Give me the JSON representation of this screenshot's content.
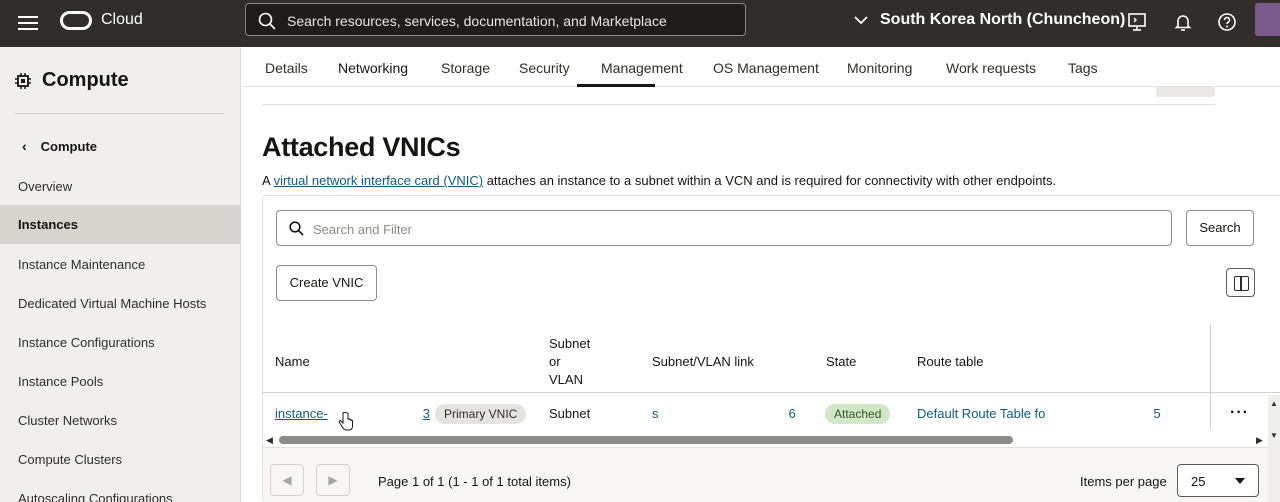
{
  "topbar": {
    "brand": "Cloud",
    "search_placeholder": "Search resources, services, documentation, and Marketplace",
    "region": "South Korea North (Chuncheon)"
  },
  "sidebar": {
    "title": "Compute",
    "back_label": "Compute",
    "items": [
      {
        "label": "Overview",
        "active": false
      },
      {
        "label": "Instances",
        "active": true
      },
      {
        "label": "Instance Maintenance",
        "active": false
      },
      {
        "label": "Dedicated Virtual Machine Hosts",
        "active": false
      },
      {
        "label": "Instance Configurations",
        "active": false
      },
      {
        "label": "Instance Pools",
        "active": false
      },
      {
        "label": "Cluster Networks",
        "active": false
      },
      {
        "label": "Compute Clusters",
        "active": false
      },
      {
        "label": "Autoscaling Configurations",
        "active": false
      }
    ]
  },
  "tabs": [
    {
      "label": "Details",
      "active": false
    },
    {
      "label": "Networking",
      "active": true
    },
    {
      "label": "Storage",
      "active": false
    },
    {
      "label": "Security",
      "active": false
    },
    {
      "label": "Management",
      "active": false
    },
    {
      "label": "OS Management",
      "active": false
    },
    {
      "label": "Monitoring",
      "active": false
    },
    {
      "label": "Work requests",
      "active": false
    },
    {
      "label": "Tags",
      "active": false
    }
  ],
  "section": {
    "title": "Attached VNICs",
    "desc_prefix": "A ",
    "desc_link": "virtual network interface card (VNIC)",
    "desc_suffix": " attaches an instance to a subnet within a VCN and is required for connectivity with other endpoints."
  },
  "toolbar": {
    "filter_placeholder": "Search and Filter",
    "search_button": "Search",
    "create_button": "Create VNIC"
  },
  "table": {
    "headers": {
      "name": "Name",
      "subnet_or_vlan_1": "Subnet",
      "subnet_or_vlan_2": "or",
      "subnet_or_vlan_3": "VLAN",
      "link": "Subnet/VLAN link",
      "state": "State",
      "route": "Route table"
    },
    "rows": [
      {
        "name_visible": "instance-",
        "name_tail": "3",
        "badge": "Primary VNIC",
        "type": "Subnet",
        "link_start": "s",
        "link_tail": "6",
        "state": "Attached",
        "route_start": "Default Route Table fo",
        "route_tail": "5"
      }
    ],
    "actions_label": "···"
  },
  "pagination": {
    "summary": "Page 1 of 1 (1 - 1 of 1 total items)",
    "items_per_page_label": "Items per page",
    "items_per_page_value": "25"
  },
  "colors": {
    "topbar": "#312d2a",
    "sidebar_bg": "#f1efed",
    "link": "#0f5c82",
    "state_attached_bg": "#d2e6c8"
  }
}
